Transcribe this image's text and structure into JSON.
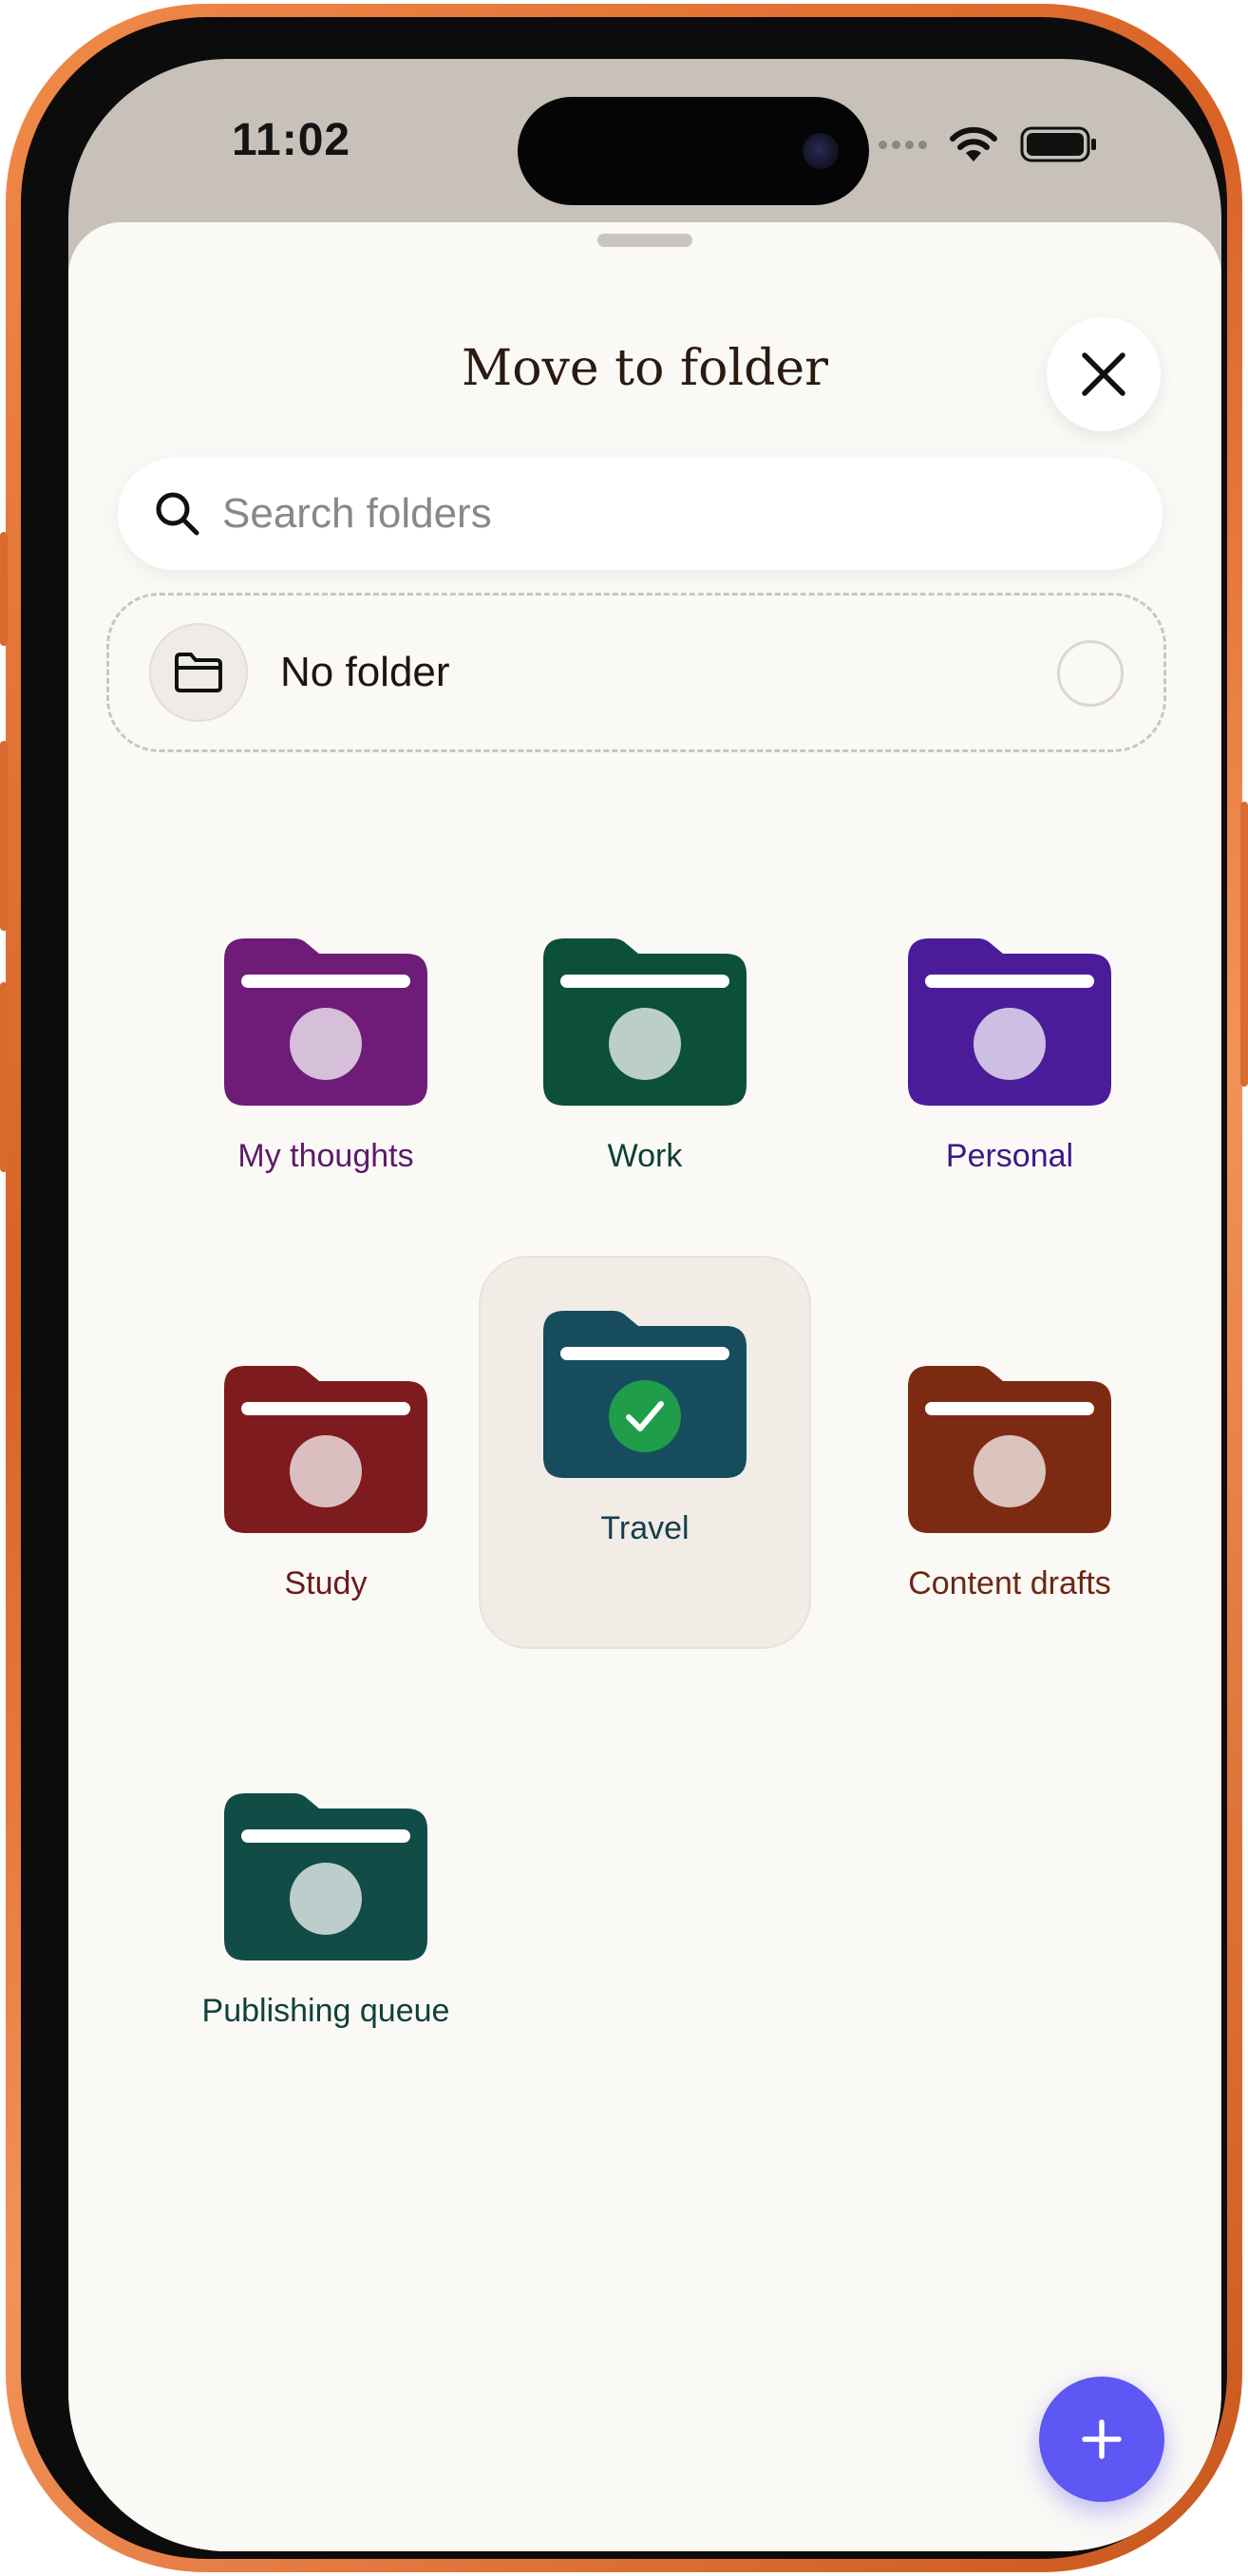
{
  "status_bar": {
    "time": "11:02"
  },
  "sheet": {
    "title": "Move to folder",
    "search": {
      "placeholder": "Search folders",
      "value": ""
    },
    "no_folder": {
      "label": "No folder",
      "selected": false
    }
  },
  "folders": [
    {
      "name": "My thoughts",
      "color": "#6e1c78",
      "label_color": "#5e1a6a",
      "selected": false
    },
    {
      "name": "Work",
      "color": "#0c4f3a",
      "label_color": "#0b3f30",
      "selected": false
    },
    {
      "name": "Personal",
      "color": "#4a1c9a",
      "label_color": "#3c1889",
      "selected": false
    },
    {
      "name": "Study",
      "color": "#7e1b1e",
      "label_color": "#6b1a1c",
      "selected": false
    },
    {
      "name": "Travel",
      "color": "#174c5e",
      "label_color": "#143f4f",
      "selected": true
    },
    {
      "name": "Content drafts",
      "color": "#7c2b12",
      "label_color": "#6d2610",
      "selected": false
    },
    {
      "name": "Publishing queue",
      "color": "#124c47",
      "label_color": "#0f403c",
      "selected": false
    }
  ],
  "colors": {
    "accent": "#5d57f4",
    "check": "#1f9d4a",
    "sheet_bg": "#fbf9f6",
    "phone_frame": "#e8743a"
  },
  "icons": {
    "close": "close-icon",
    "search": "search-icon",
    "no_folder": "folder-outline-icon",
    "fab": "plus-icon"
  }
}
